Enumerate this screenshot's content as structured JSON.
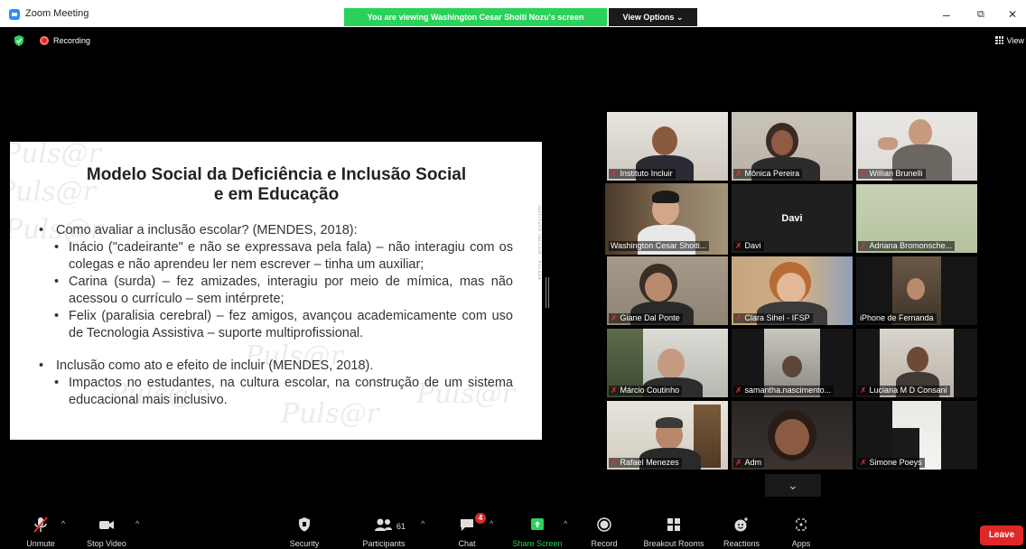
{
  "window": {
    "title": "Zoom Meeting",
    "banner": "You are viewing Washington Cesar Shoiti Nozu's screen",
    "view_options": "View Options ⌄",
    "minimize": "–",
    "restore": "⧉",
    "close": "✕"
  },
  "status": {
    "recording": "Recording",
    "view": "View"
  },
  "slide": {
    "title_line1": "Modelo Social da Deficiência e Inclusão Social",
    "title_line2": "e em Educação",
    "side_note": "INSTITUTO INCLUIR · PULSAR",
    "watermark": "Puls@r",
    "q1": "Como avaliar a inclusão escolar? (MENDES, 2018):",
    "i1": "Inácio (\"cadeirante\" e não se expressava pela fala) – não interagiu com os colegas e não aprendeu ler nem escrever – tinha um auxiliar;",
    "i2": "Carina (surda) – fez amizades, interagiu por meio de mímica, mas não acessou o currículo – sem intérprete;",
    "i3": "Felix (paralisia cerebral) – fez amigos, avançou academicamente com uso de Tecnologia Assistiva – suporte multiprofissional.",
    "q2": "Inclusão como ato e efeito de incluir (MENDES, 2018).",
    "i4": "Impactos no estudantes, na cultura escolar, na construção de um sistema educacional mais inclusivo."
  },
  "participants": [
    {
      "name": "Instituto Incluir"
    },
    {
      "name": "Mônica Pereira"
    },
    {
      "name": "Willian Brunelli"
    },
    {
      "name": "Washington Cesar Shoiti..."
    },
    {
      "name": "Davi",
      "center": "Davi"
    },
    {
      "name": "Adriana Bromonsche..."
    },
    {
      "name": "Giane Dal Ponte"
    },
    {
      "name": "Clara Sihel - IFSP"
    },
    {
      "name": "iPhone de Fernanda"
    },
    {
      "name": "Márcio Coutinho"
    },
    {
      "name": "samantha.nascimento..."
    },
    {
      "name": "Luciana M D Consani"
    },
    {
      "name": "Rafael Menezes"
    },
    {
      "name": "Adm"
    },
    {
      "name": "Simone Poeys"
    }
  ],
  "toolbar": {
    "unmute": "Unmute",
    "stop_video": "Stop Video",
    "security": "Security",
    "participants": "Participants",
    "participants_count": "61",
    "chat": "Chat",
    "chat_badge": "4",
    "share_screen": "Share Screen",
    "record": "Record",
    "breakout": "Breakout Rooms",
    "reactions": "Reactions",
    "apps": "Apps",
    "leave": "Leave"
  },
  "colors": {
    "banner_green": "#2ad15a",
    "share_green": "#2ad15a",
    "leave_red": "#e02828",
    "active_speaker": "#c6e33b"
  }
}
